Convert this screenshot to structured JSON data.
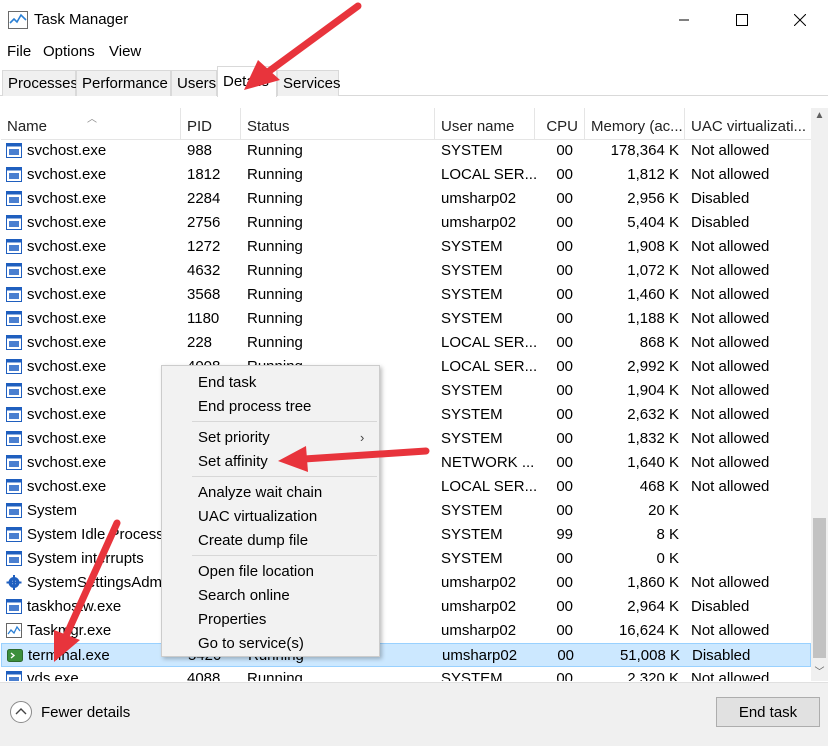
{
  "window": {
    "title": "Task Manager"
  },
  "menu": {
    "items": [
      "File",
      "Options",
      "View"
    ]
  },
  "tabs": [
    "Processes",
    "Performance",
    "Users",
    "Details",
    "Services"
  ],
  "active_tab": "Details",
  "table": {
    "columns": [
      "Name",
      "PID",
      "Status",
      "User name",
      "CPU",
      "Memory (ac...",
      "UAC virtualizati..."
    ],
    "rows": [
      [
        "svchost.exe",
        "988",
        "Running",
        "SYSTEM",
        "00",
        "178,364 K",
        "Not allowed"
      ],
      [
        "svchost.exe",
        "1812",
        "Running",
        "LOCAL SER...",
        "00",
        "1,812 K",
        "Not allowed"
      ],
      [
        "svchost.exe",
        "2284",
        "Running",
        "umsharp02",
        "00",
        "2,956 K",
        "Disabled"
      ],
      [
        "svchost.exe",
        "2756",
        "Running",
        "umsharp02",
        "00",
        "5,404 K",
        "Disabled"
      ],
      [
        "svchost.exe",
        "1272",
        "Running",
        "SYSTEM",
        "00",
        "1,908 K",
        "Not allowed"
      ],
      [
        "svchost.exe",
        "4632",
        "Running",
        "SYSTEM",
        "00",
        "1,072 K",
        "Not allowed"
      ],
      [
        "svchost.exe",
        "3568",
        "Running",
        "SYSTEM",
        "00",
        "1,460 K",
        "Not allowed"
      ],
      [
        "svchost.exe",
        "1180",
        "Running",
        "SYSTEM",
        "00",
        "1,188 K",
        "Not allowed"
      ],
      [
        "svchost.exe",
        "228",
        "Running",
        "LOCAL SER...",
        "00",
        "868 K",
        "Not allowed"
      ],
      [
        "svchost.exe",
        "4008",
        "Running",
        "LOCAL SER...",
        "00",
        "2,992 K",
        "Not allowed"
      ],
      [
        "svchost.exe",
        "",
        "",
        "SYSTEM",
        "00",
        "1,904 K",
        "Not allowed"
      ],
      [
        "svchost.exe",
        "",
        "",
        "SYSTEM",
        "00",
        "2,632 K",
        "Not allowed"
      ],
      [
        "svchost.exe",
        "",
        "",
        "SYSTEM",
        "00",
        "1,832 K",
        "Not allowed"
      ],
      [
        "svchost.exe",
        "",
        "",
        "NETWORK ...",
        "00",
        "1,640 K",
        "Not allowed"
      ],
      [
        "svchost.exe",
        "",
        "",
        "LOCAL SER...",
        "00",
        "468 K",
        "Not allowed"
      ],
      [
        "System",
        "",
        "",
        "SYSTEM",
        "00",
        "20 K",
        ""
      ],
      [
        "System Idle Process",
        "",
        "",
        "SYSTEM",
        "99",
        "8 K",
        ""
      ],
      [
        "System interrupts",
        "",
        "",
        "SYSTEM",
        "00",
        "0 K",
        ""
      ],
      [
        "SystemSettingsAdmi...",
        "",
        "",
        "umsharp02",
        "00",
        "1,860 K",
        "Not allowed"
      ],
      [
        "taskhostw.exe",
        "",
        "",
        "umsharp02",
        "00",
        "2,964 K",
        "Disabled"
      ],
      [
        "Taskmgr.exe",
        "",
        "",
        "umsharp02",
        "00",
        "16,624 K",
        "Not allowed"
      ],
      [
        "terminal.exe",
        "5420",
        "Running",
        "umsharp02",
        "00",
        "51,008 K",
        "Disabled"
      ],
      [
        "vds.exe",
        "4088",
        "Running",
        "SYSTEM",
        "00",
        "2,320 K",
        "Not allowed"
      ]
    ],
    "row_icons": [
      "svc",
      "svc",
      "svc",
      "svc",
      "svc",
      "svc",
      "svc",
      "svc",
      "svc",
      "svc",
      "svc",
      "svc",
      "svc",
      "svc",
      "svc",
      "svc",
      "svc",
      "svc",
      "gear",
      "svc",
      "chart",
      "terminal",
      "svc"
    ],
    "selected_row": "terminal.exe"
  },
  "context_menu": {
    "items": [
      "End task",
      "End process tree",
      "Set priority",
      "Set affinity",
      "Analyze wait chain",
      "UAC virtualization",
      "Create dump file",
      "Open file location",
      "Search online",
      "Properties",
      "Go to service(s)"
    ],
    "submenu_item": "Set priority"
  },
  "footer": {
    "fewer_details": "Fewer details",
    "end_task": "End task"
  },
  "colors": {
    "selection": "#cce8ff",
    "annotation_arrow": "#e8343c",
    "icon_blue": "#1f5fbf"
  }
}
